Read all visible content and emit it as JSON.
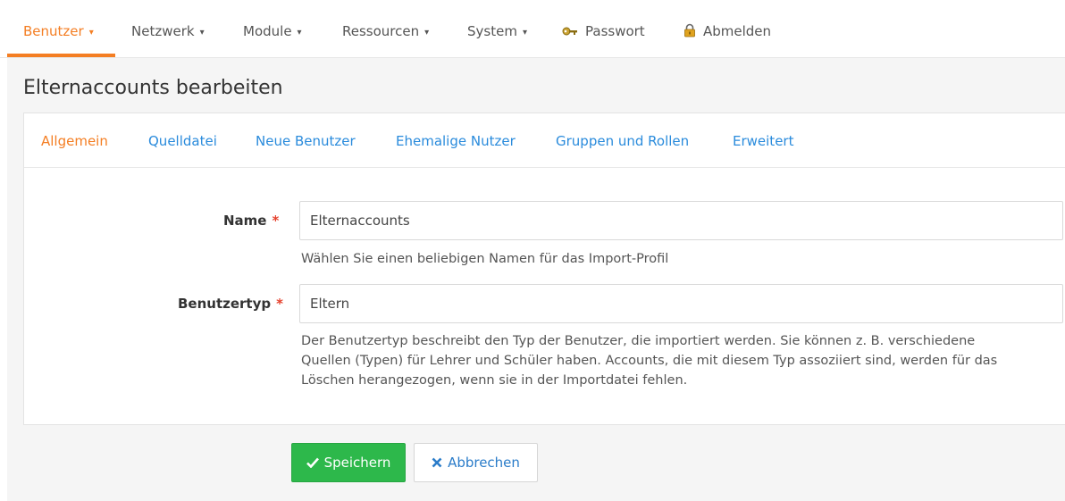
{
  "nav": {
    "items": [
      {
        "label": "Benutzer",
        "caret": "▾"
      },
      {
        "label": "Netzwerk",
        "caret": "▾"
      },
      {
        "label": "Module",
        "caret": "▾"
      },
      {
        "label": "Ressourcen",
        "caret": "▾"
      },
      {
        "label": "System",
        "caret": "▾"
      }
    ],
    "password": {
      "label": "Passwort",
      "icon": "key-icon"
    },
    "logout": {
      "label": "Abmelden",
      "icon": "lock-icon"
    },
    "accent_color": "#f47e23"
  },
  "page": {
    "title": "Elternaccounts bearbeiten"
  },
  "tabs": [
    {
      "label": "Allgemein"
    },
    {
      "label": "Quelldatei"
    },
    {
      "label": "Neue Benutzer"
    },
    {
      "label": "Ehemalige Nutzer"
    },
    {
      "label": "Gruppen und Rollen"
    },
    {
      "label": "Erweitert"
    }
  ],
  "form": {
    "name": {
      "label": "Name",
      "required_mark": "*",
      "value": "Elternaccounts",
      "help": "Wählen Sie einen beliebigen Namen für das Import-Profil"
    },
    "usertype": {
      "label": "Benutzertyp",
      "required_mark": "*",
      "value": "Eltern",
      "help_line1": "Der Benutzertyp beschreibt den Typ der Benutzer, die importiert werden. Sie können z. B. verschiedene",
      "help_line2": "Quellen (Typen) für Lehrer und Schüler haben. Accounts, die mit diesem Typ assoziiert sind, werden für das",
      "help_line3": "Löschen herangezogen, wenn sie in der Importdatei fehlen."
    }
  },
  "buttons": {
    "save": {
      "label": "Speichern",
      "icon": "check-icon",
      "color": "#2db84b"
    },
    "cancel": {
      "label": "Abbrechen",
      "icon": "x-icon"
    }
  }
}
